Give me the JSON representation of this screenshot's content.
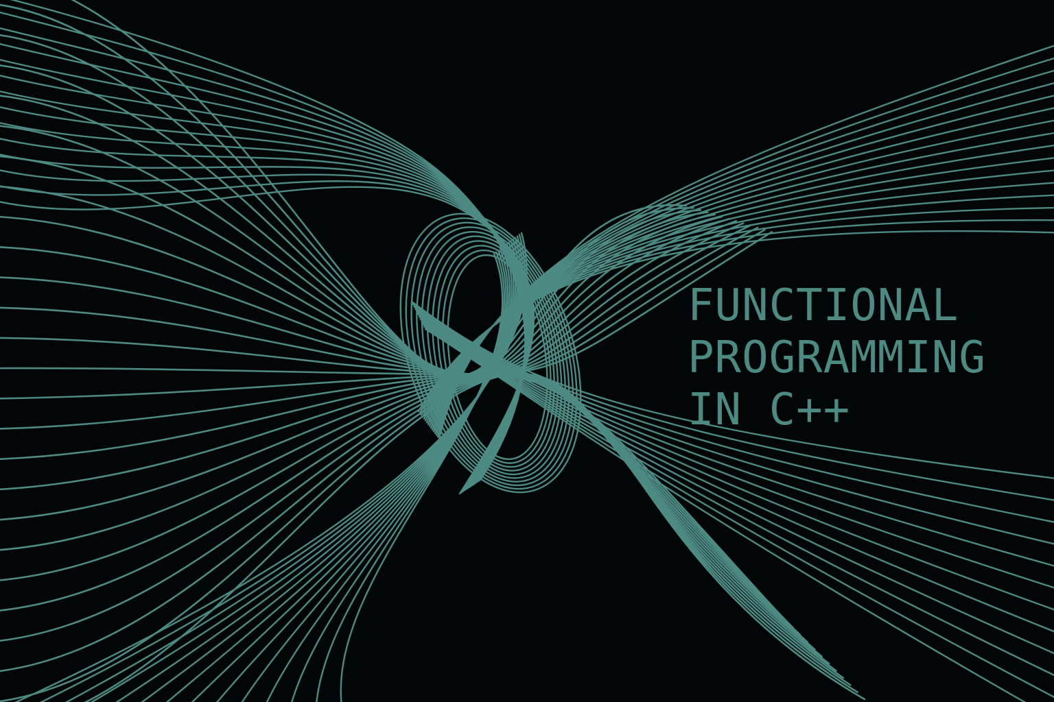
{
  "cover": {
    "title_lines": [
      "FUNCTIONAL",
      "PROGRAMMING",
      "IN C++"
    ]
  },
  "colors": {
    "background": "#030606",
    "accent": "#4E8A84"
  },
  "artwork": {
    "description_icon": "intertwined-wave-lines-artwork"
  }
}
